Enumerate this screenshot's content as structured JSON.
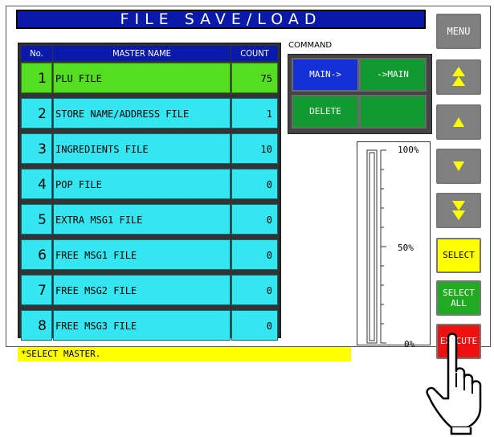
{
  "title": "FILE SAVE/LOAD",
  "table": {
    "headers": {
      "no": "No.",
      "name": "MASTER NAME",
      "count": "COUNT"
    },
    "rows": [
      {
        "no": "1",
        "name": "PLU FILE",
        "count": "75",
        "selected": true
      },
      {
        "no": "2",
        "name": "STORE NAME/ADDRESS FILE",
        "count": "1"
      },
      {
        "no": "3",
        "name": "INGREDIENTS FILE",
        "count": "10"
      },
      {
        "no": "4",
        "name": "POP FILE",
        "count": "0"
      },
      {
        "no": "5",
        "name": "EXTRA MSG1 FILE",
        "count": "0"
      },
      {
        "no": "6",
        "name": "FREE MSG1 FILE",
        "count": "0"
      },
      {
        "no": "7",
        "name": "FREE MSG2 FILE",
        "count": "0"
      },
      {
        "no": "8",
        "name": "FREE MSG3 FILE",
        "count": "0"
      }
    ]
  },
  "command": {
    "label": "COMMAND",
    "main_to": "MAIN->",
    "to_main": "->MAIN",
    "delete": "DELETE",
    "empty": ""
  },
  "progress": {
    "top": "100%",
    "mid": "50%",
    "bottom": "0%",
    "value_percent": 0
  },
  "side": {
    "menu": "MENU",
    "page_up_icon": "double-up-triangle",
    "up_icon": "up-triangle",
    "down_icon": "down-triangle",
    "page_down_icon": "double-down-triangle",
    "select": "SELECT",
    "select_all_1": "SELECT",
    "select_all_2": "ALL",
    "execute": "EXECUTE"
  },
  "status": "*SELECT MASTER.",
  "colors": {
    "title_bg": "#0a1aa8",
    "row_bg": "#33e6f0",
    "row_selected_bg": "#55dd22",
    "arrow": "#ffff00",
    "select_bg": "#ffff00",
    "select_all_bg": "#22aa22",
    "execute_bg": "#ee1111"
  }
}
